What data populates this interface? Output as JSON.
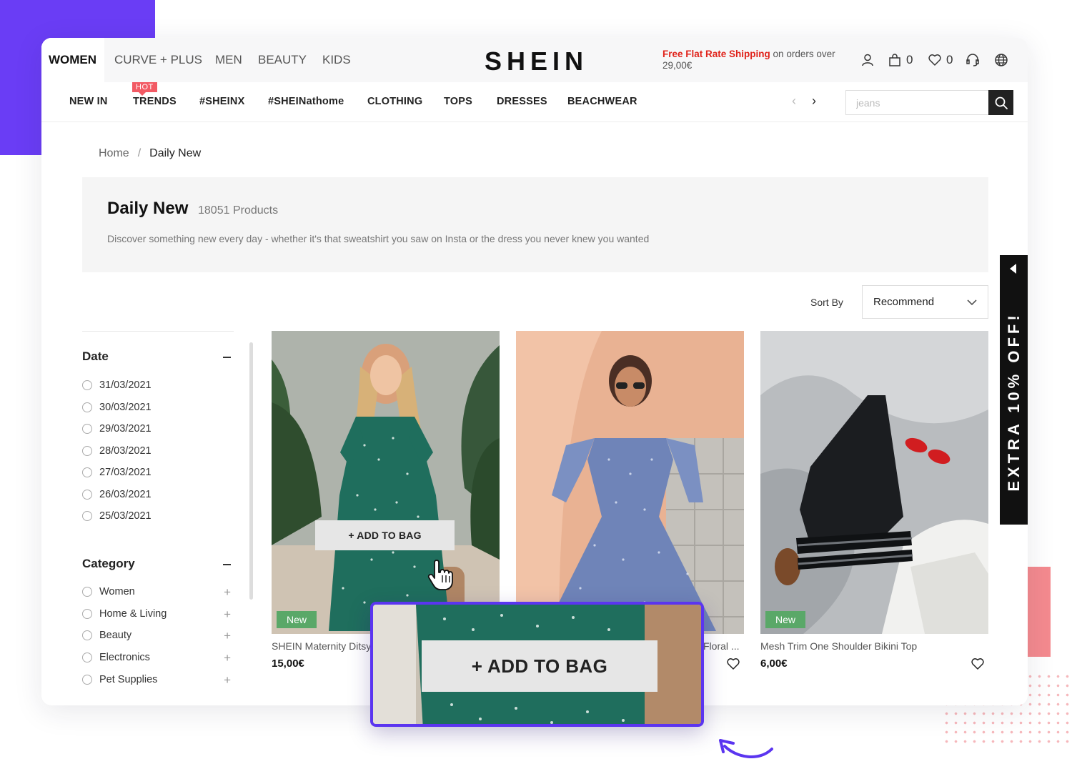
{
  "header": {
    "categories": [
      {
        "label": "WOMEN",
        "active": true
      },
      {
        "label": "CURVE + PLUS"
      },
      {
        "label": "MEN"
      },
      {
        "label": "BEAUTY"
      },
      {
        "label": "KIDS"
      }
    ],
    "logo": "SHEIN",
    "promo_highlight": "Free Flat Rate Shipping",
    "promo_rest": "on orders over 29,00€",
    "bag_count": "0",
    "wishlist_count": "0"
  },
  "nav": {
    "items": [
      "NEW IN",
      "TRENDS",
      "#SHEINX",
      "#SHEINathome",
      "CLOTHING",
      "TOPS",
      "DRESSES",
      "BEACHWEAR"
    ],
    "hot_badge": "HOT",
    "search_placeholder": "jeans"
  },
  "breadcrumb": {
    "home": "Home",
    "separator": "/",
    "current": "Daily New"
  },
  "intro": {
    "title": "Daily New",
    "count": "18051 Products",
    "description": "Discover something new every day - whether it's that sweatshirt you saw on Insta or the dress you never knew you wanted"
  },
  "sort": {
    "label": "Sort By",
    "selected": "Recommend"
  },
  "filters": {
    "date_title": "Date",
    "dates": [
      "31/03/2021",
      "30/03/2021",
      "29/03/2021",
      "28/03/2021",
      "27/03/2021",
      "26/03/2021",
      "25/03/2021"
    ],
    "category_title": "Category",
    "categories": [
      "Women",
      "Home & Living",
      "Beauty",
      "Electronics",
      "Pet Supplies"
    ]
  },
  "products": [
    {
      "name": "SHEIN Maternity Ditsy",
      "price": "15,00€",
      "badge": "New",
      "hover_button": "+ ADD TO BAG"
    },
    {
      "name": "Floral ...",
      "price": "",
      "badge": ""
    },
    {
      "name": "Mesh Trim One Shoulder Bikini Top",
      "price": "6,00€",
      "badge": "New"
    }
  ],
  "zoom_callout": {
    "button_label": "+ ADD TO BAG"
  },
  "side_banner": {
    "text": "EXTRA 10% OFF!"
  },
  "colors": {
    "accent": "#5b35f0",
    "promo_red": "#e0231b",
    "new_badge": "#5aa868",
    "hot_badge": "#f25a64"
  }
}
